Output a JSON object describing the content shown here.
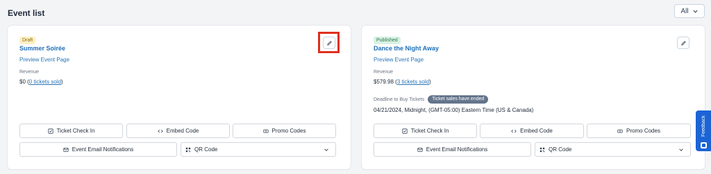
{
  "header": {
    "title": "Event list",
    "filter_value": "All"
  },
  "events": [
    {
      "status": "Draft",
      "name": "Summer Soirée",
      "preview_label": "Preview Event Page",
      "revenue_label": "Revenue",
      "revenue_amount": "$0",
      "tickets_sold": "0 tickets sold"
    },
    {
      "status": "Published",
      "name": "Dance the Night Away",
      "preview_label": "Preview Event Page",
      "revenue_label": "Revenue",
      "revenue_amount": "$579.98",
      "tickets_sold": "3 tickets sold",
      "deadline_label": "Deadline to Buy Tickets",
      "deadline_status": "Ticket sales have ended",
      "deadline_value": "04/21/2024, Midnight, (GMT-05:00) Eastern Time (US & Canada)"
    }
  ],
  "actions": {
    "check_in": "Ticket Check In",
    "embed_code": "Embed Code",
    "promo_codes": "Promo Codes",
    "email_notifications": "Event Email Notifications",
    "qr_code": "QR Code"
  },
  "feedback": {
    "label": "Feedback"
  },
  "colors": {
    "accent": "#1d6fb8",
    "highlight": "#e02f1e",
    "feedback": "#1c64d6"
  }
}
